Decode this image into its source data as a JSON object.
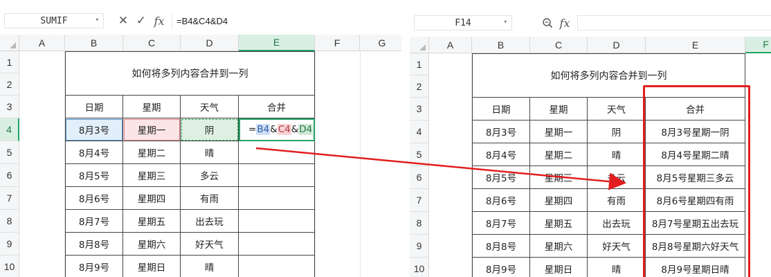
{
  "left": {
    "name_box": "SUMIF",
    "formula": "=B4&C4&D4",
    "columns": [
      "A",
      "B",
      "C",
      "D",
      "E",
      "F",
      "G"
    ],
    "rows": [
      "1",
      "2",
      "3",
      "4",
      "5",
      "6",
      "7",
      "8",
      "9",
      "10"
    ],
    "title": "如何将多列内容合并到一列",
    "headers": [
      "日期",
      "星期",
      "天气",
      "合并"
    ],
    "data": [
      [
        "8月3号",
        "星期一",
        "阴"
      ],
      [
        "8月4号",
        "星期二",
        "晴"
      ],
      [
        "8月5号",
        "星期三",
        "多云"
      ],
      [
        "8月6号",
        "星期四",
        "有雨"
      ],
      [
        "8月7号",
        "星期五",
        "出去玩"
      ],
      [
        "8月8号",
        "星期六",
        "好天气"
      ],
      [
        "8月9号",
        "星期日",
        "晴"
      ]
    ],
    "edit_formula_parts": {
      "eq": "=",
      "b": "B4",
      "amp1": "&",
      "c": "C4",
      "amp2": "&",
      "d": "D4"
    }
  },
  "right": {
    "name_box": "F14",
    "formula": "",
    "columns": [
      "A",
      "B",
      "C",
      "D",
      "E",
      "F"
    ],
    "rows": [
      "1",
      "2",
      "3",
      "4",
      "5",
      "6",
      "7",
      "8",
      "9",
      "10"
    ],
    "title": "如何将多列内容合并到一列",
    "headers": [
      "日期",
      "星期",
      "天气",
      "合并"
    ],
    "data": [
      [
        "8月3号",
        "星期一",
        "阴",
        "8月3号星期一阴"
      ],
      [
        "8月4号",
        "星期二",
        "晴",
        "8月4号星期二晴"
      ],
      [
        "8月5号",
        "星期三",
        "多云",
        "8月5号星期三多云"
      ],
      [
        "8月6号",
        "星期四",
        "有雨",
        "8月6号星期四有雨"
      ],
      [
        "8月7号",
        "星期五",
        "出去玩",
        "8月7号星期五出去玩"
      ],
      [
        "8月8号",
        "星期六",
        "好天气",
        "8月8号星期六好天气"
      ],
      [
        "8月9号",
        "星期日",
        "晴",
        "8月9号星期日晴"
      ]
    ]
  },
  "icons": {
    "cancel": "close-icon",
    "confirm": "check-icon",
    "fx": "function-icon",
    "zoom": "zoom-search-icon",
    "dropdown": "chevron-down-icon"
  },
  "colors": {
    "selection_green": "#21a366",
    "annotation_red": "#e21e1e"
  }
}
